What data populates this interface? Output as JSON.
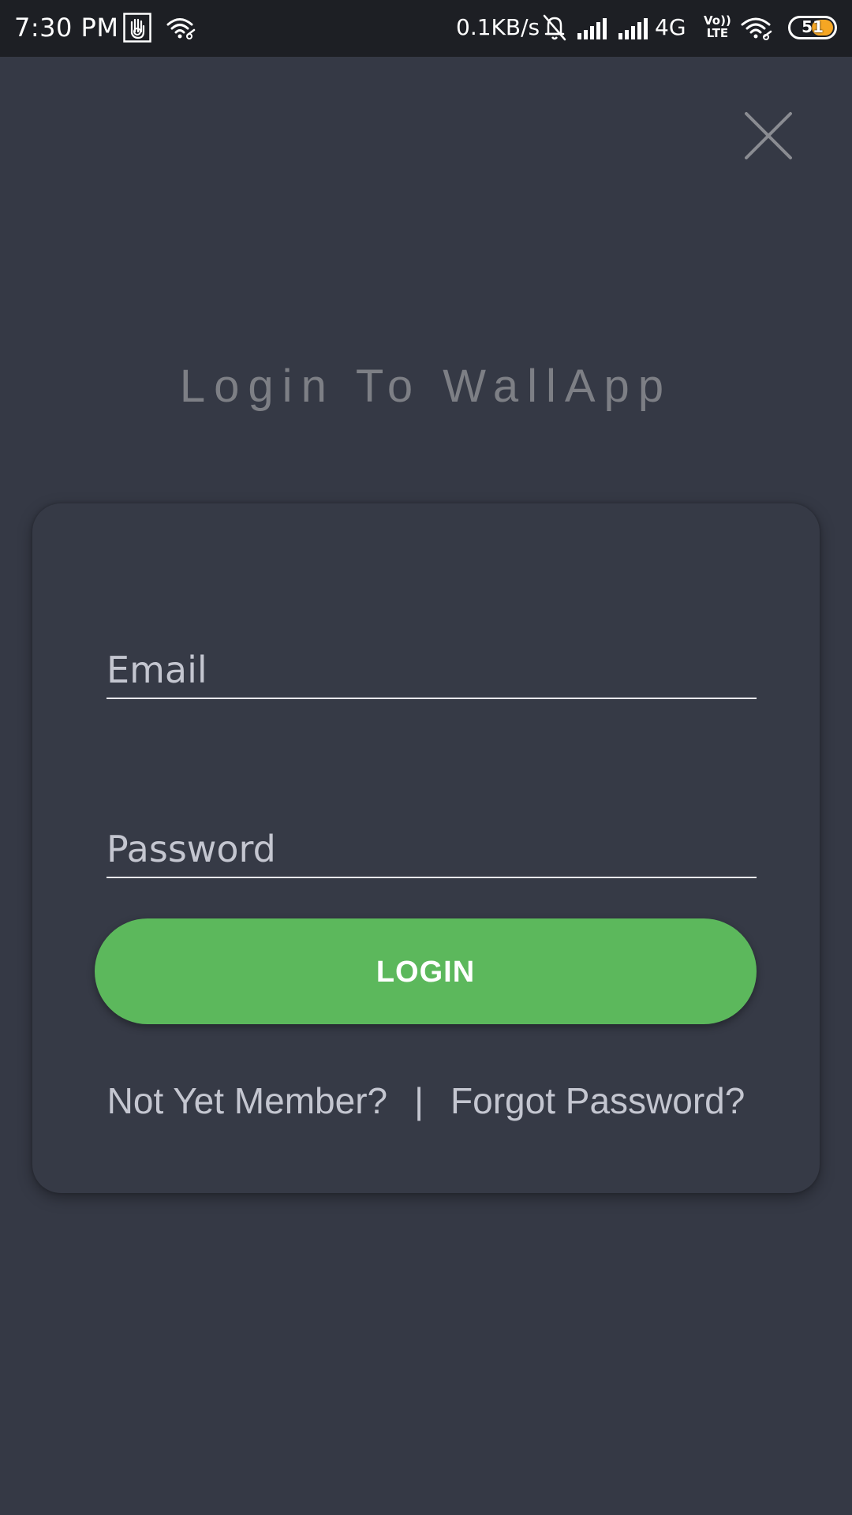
{
  "status_bar": {
    "time": "7:30 PM",
    "network_speed": "0.1KB/s",
    "network_type": "4G",
    "volte_top": "Vo))",
    "volte_bottom": "LTE",
    "battery_level": "51",
    "battery_fraction": 0.51,
    "icons": [
      "hand-notification-icon",
      "wifi-icon",
      "mute-bell-icon",
      "signal-icon",
      "signal-icon",
      "wifi-icon",
      "battery-icon"
    ]
  },
  "close_icon": "close-icon",
  "title": "Login To WallApp",
  "form": {
    "email_placeholder": "Email",
    "email_value": "",
    "password_placeholder": "Password",
    "password_value": "",
    "login_label": "LOGIN",
    "not_member_link": "Not Yet Member?",
    "separator": "|",
    "forgot_link": "Forgot Password?"
  },
  "colors": {
    "background": "#353945",
    "card": "#363a46",
    "accent_button": "#5cb85c",
    "title": "#7d7f85",
    "status_bar": "#1d1f24",
    "battery": "#f5a623"
  }
}
